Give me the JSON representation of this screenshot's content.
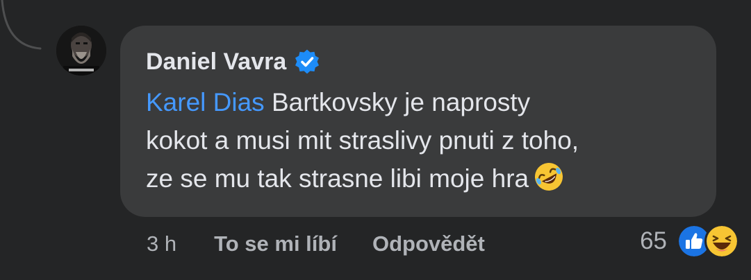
{
  "comment": {
    "author": "Daniel Vavra",
    "verified": true,
    "mention": "Karel Dias",
    "text_lines": [
      "Bartkovsky je naprosty",
      "kokot a musi mit straslivy pnuti z toho,",
      "ze se mu tak strasne libi moje hra"
    ],
    "inline_emoji": "rolling-on-floor-laughing-emoji"
  },
  "actions": {
    "time": "3 h",
    "like_label": "To se mi líbí",
    "reply_label": "Odpovědět"
  },
  "reactions": {
    "count": "65",
    "icons": [
      "like-icon",
      "haha-icon"
    ]
  },
  "colors": {
    "background": "#242526",
    "bubble": "#3a3b3c",
    "text": "#e4e6eb",
    "muted": "#b0b3b8",
    "mention": "#4599ff",
    "verified_blue": "#1d8cf8"
  }
}
